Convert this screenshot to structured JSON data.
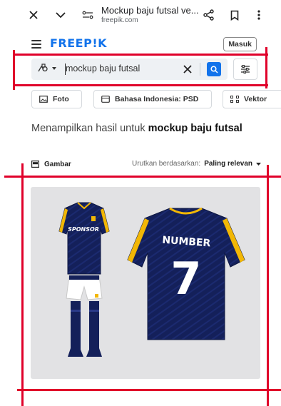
{
  "browser": {
    "page_title": "Mockup baju futsal ve...",
    "host": "freepik.com",
    "icons": [
      "close-icon",
      "chevron-down-icon",
      "site-settings-icon",
      "share-icon",
      "bookmark-icon",
      "more-vert-icon"
    ]
  },
  "site": {
    "logo": "FREEP!K",
    "login_label": "Masuk"
  },
  "search": {
    "query": "mockup baju futsal",
    "type_icon": "asset-type-icon",
    "accent": "#1273eb"
  },
  "chips": [
    {
      "label": "Foto",
      "icon": "photo-icon"
    },
    {
      "label": "Bahasa Indonesia: PSD",
      "icon": "psd-file-icon"
    },
    {
      "label": "Vektor",
      "icon": "vector-icon"
    }
  ],
  "results": {
    "prefix": "Menampilkan hasil untuk ",
    "query": "mockup baju futsal"
  },
  "section": {
    "label": "Gambar",
    "sort_prefix": "Urutkan berdasarkan:",
    "sort_value": "Paling relevan"
  },
  "image": {
    "jersey_left_text": "SPONSOR",
    "jersey_right_name": "NUMBER",
    "jersey_right_number": "7",
    "colors": {
      "navy": "#14205a",
      "gold": "#f2b705",
      "bg": "#e2e2e4"
    }
  }
}
